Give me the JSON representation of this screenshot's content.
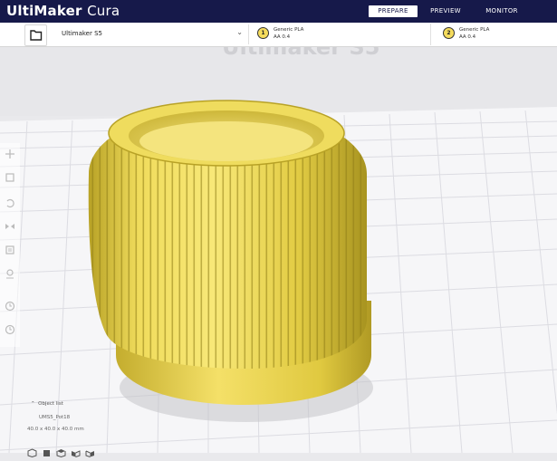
{
  "app": {
    "brand_bold": "UltiMaker",
    "brand_light": "Cura"
  },
  "stages": [
    {
      "label": "PREPARE",
      "active": true
    },
    {
      "label": "PREVIEW",
      "active": false
    },
    {
      "label": "MONITOR",
      "active": false
    }
  ],
  "toolbar": {
    "printer": "Ultimaker S5",
    "extruders": [
      {
        "number": "1",
        "material": "Generic PLA",
        "nozzle": "AA 0.4"
      },
      {
        "number": "2",
        "material": "Generic PLA",
        "nozzle": "AA 0.4"
      }
    ]
  },
  "viewport": {
    "printer_watermark": "Ultimaker S5",
    "model_color": "#e8d24a"
  },
  "left_tools": [
    "move-icon",
    "scale-icon",
    "rotate-icon",
    "mirror-icon",
    "per-model-settings-icon",
    "support-blocker-icon",
    "history-icon",
    "history-icon"
  ],
  "object_list": {
    "title": "Object list",
    "file_name": "UMS5_Pot18",
    "dimensions": "40.0 x 40.0 x 40.0 mm"
  },
  "colors": {
    "header": "#16194a",
    "accent": "#f5dc5c"
  }
}
